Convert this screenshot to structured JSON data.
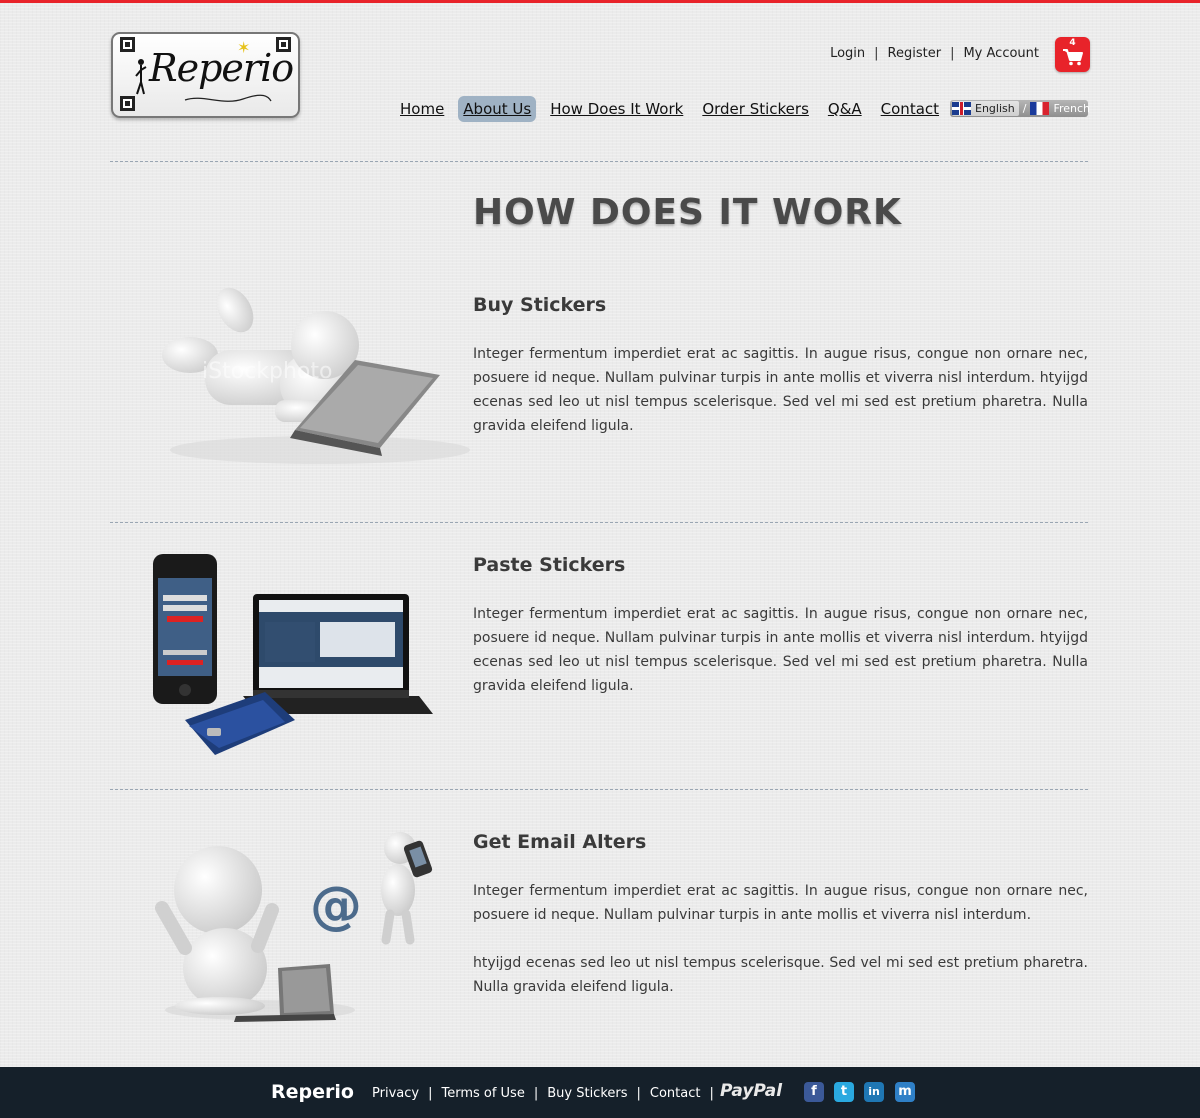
{
  "header": {
    "logo_text": "Reperio",
    "top_links": [
      "Login",
      "Register",
      "My Account"
    ],
    "cart_count": "4",
    "nav": [
      "Home",
      "About Us",
      "How Does It Work",
      "Order Stickers",
      "Q&A",
      "Contact"
    ],
    "active_nav": "About Us",
    "languages": [
      "English",
      "French"
    ]
  },
  "page": {
    "title": "HOW DOES IT WORK",
    "sections": [
      {
        "title": "Buy Stickers",
        "paragraphs": [
          "Integer fermentum imperdiet erat ac sagittis. In augue risus, congue non ornare nec, posuere id neque. Nullam pulvinar turpis in ante mollis et viverra nisl interdum. htyijgd ecenas sed leo ut nisl tempus scelerisque. Sed vel mi sed est pretium pharetra. Nulla gravida eleifend ligula."
        ],
        "image_watermark": "iStockphoto"
      },
      {
        "title": "Paste Stickers",
        "paragraphs": [
          "Integer fermentum imperdiet erat ac sagittis. In augue risus, congue non ornare nec, posuere id neque. Nullam pulvinar turpis in ante mollis et viverra nisl interdum. htyijgd ecenas sed leo ut nisl tempus scelerisque. Sed vel mi sed est pretium pharetra. Nulla gravida eleifend ligula."
        ]
      },
      {
        "title": "Get Email Alters",
        "paragraphs": [
          "Integer fermentum imperdiet erat ac sagittis. In augue risus, congue non ornare nec, posuere id neque. Nullam pulvinar turpis in ante mollis et viverra nisl interdum.",
          "htyijgd ecenas sed leo ut nisl tempus scelerisque. Sed vel mi sed est pretium pharetra. Nulla gravida eleifend ligula."
        ]
      }
    ]
  },
  "footer": {
    "brand": "Reperio",
    "links": [
      "Privacy",
      "Terms of Use",
      "Buy Stickers",
      "Contact"
    ],
    "payment": "PayPal",
    "social": [
      {
        "icon": "facebook-icon",
        "glyph": "f",
        "color": "#3b5998"
      },
      {
        "icon": "twitter-icon",
        "glyph": "t",
        "color": "#2aa9e0"
      },
      {
        "icon": "linkedin-icon",
        "glyph": "in",
        "color": "#1f77b4"
      },
      {
        "icon": "myspace-icon",
        "glyph": "m",
        "color": "#2f80c7"
      }
    ]
  },
  "colors": {
    "accent_red": "#e8232a",
    "footer_bg": "#15202a",
    "nav_active_bg": "#9fb2c4"
  }
}
